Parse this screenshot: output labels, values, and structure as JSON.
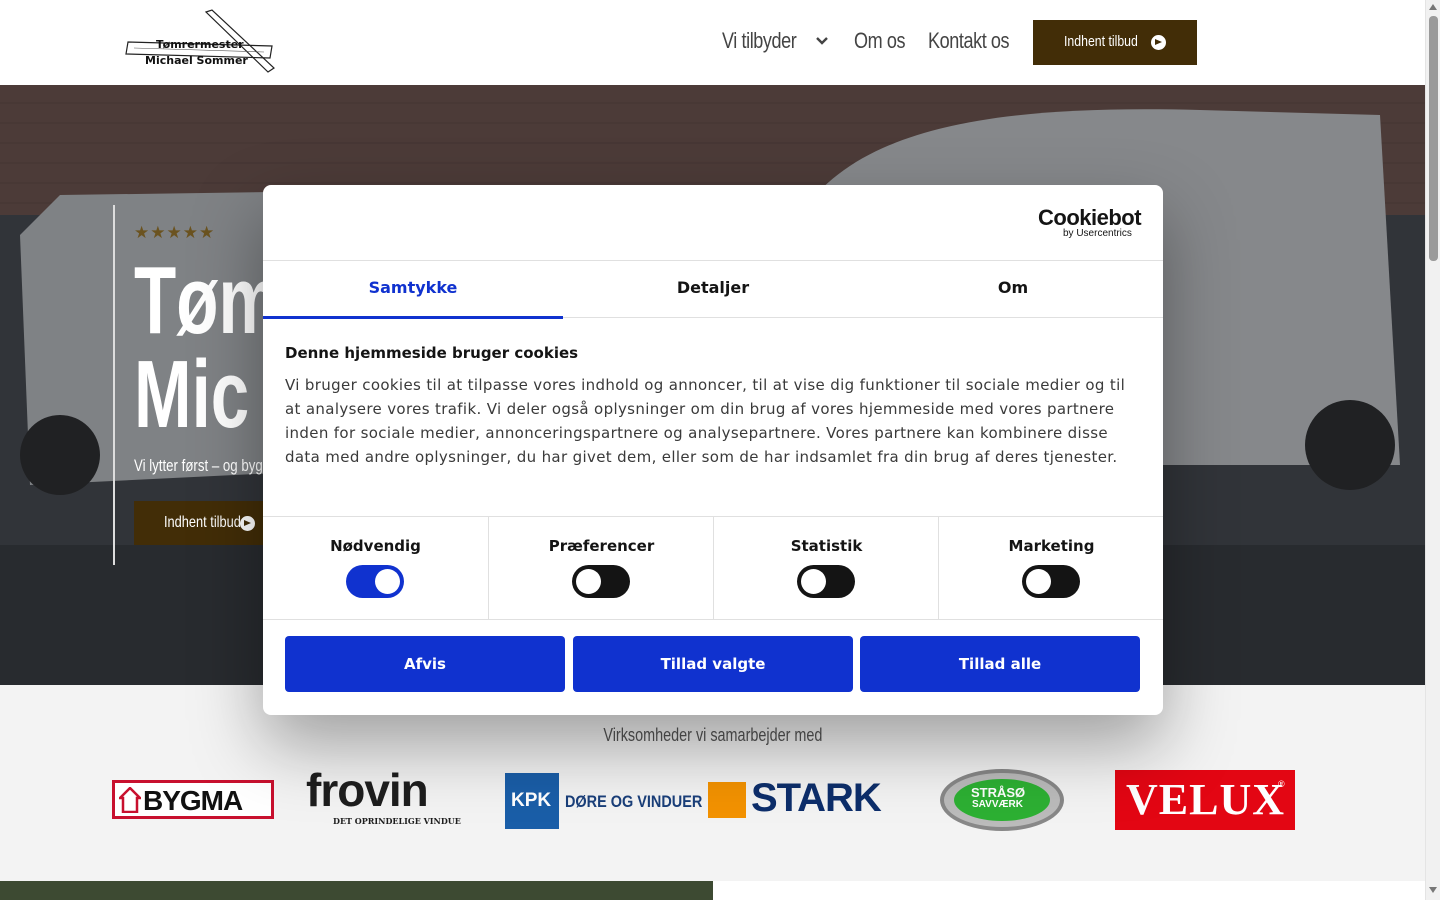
{
  "header": {
    "logo_line1": "Tømrermester",
    "logo_line2": "Michael Sommer",
    "nav": [
      "Vi tilbyder",
      "Om os",
      "Kontakt os"
    ],
    "cta": "Indhent tilbud"
  },
  "hero": {
    "stars": "★★★★★",
    "title_line1": "Tøm",
    "title_line2": "Mic",
    "subtitle": "Vi lytter først – og bygg",
    "cta": "Indhent tilbud"
  },
  "partners": {
    "title": "Virksomheder vi samarbejder med",
    "logos": {
      "bygma": "BYGMA",
      "frovin": "frovin",
      "frovin_sub": "DET OPRINDELIGE VINDUE",
      "kpk": "KPK",
      "kpk_sub": "DØRE OG VINDUER",
      "stark": "STARK",
      "straso1": "STRÅSØ",
      "straso2": "SAVVÆRK",
      "velux": "VELUX",
      "velux_r": "®"
    }
  },
  "cookie": {
    "brand": "Cookiebot",
    "brand_sub": "by Usercentrics",
    "tabs": [
      "Samtykke",
      "Detaljer",
      "Om"
    ],
    "active_tab": "Samtykke",
    "title": "Denne hjemmeside bruger cookies",
    "body": "Vi bruger cookies til at tilpasse vores indhold og annoncer, til at vise dig funktioner til sociale medier og til at analysere vores trafik. Vi deler også oplysninger om din brug af vores hjemmeside med vores partnere inden for sociale medier, annonceringspartnere og analysepartnere. Vores partnere kan kombinere disse data med andre oplysninger, du har givet dem, eller som de har indsamlet fra din brug af deres tjenester.",
    "toggles": [
      {
        "label": "Nødvendig",
        "on": true
      },
      {
        "label": "Præferencer",
        "on": false
      },
      {
        "label": "Statistik",
        "on": false
      },
      {
        "label": "Marketing",
        "on": false
      }
    ],
    "buttons": [
      "Afvis",
      "Tillad valgte",
      "Tillad alle"
    ]
  },
  "colors": {
    "accent": "#1032cf",
    "brand_brown": "#422d07"
  }
}
